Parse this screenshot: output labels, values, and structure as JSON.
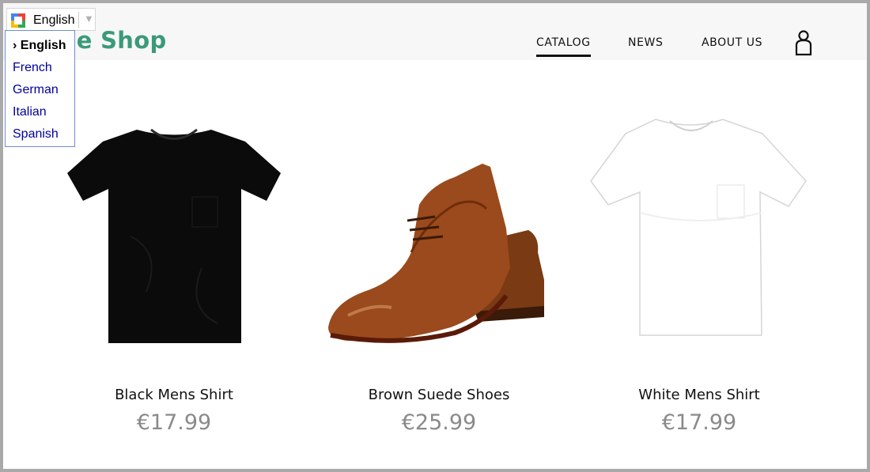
{
  "header": {
    "logo_text": "Acme Shop",
    "nav": [
      {
        "label": "CATALOG",
        "active": true
      },
      {
        "label": "NEWS"
      },
      {
        "label": "ABOUT US"
      }
    ],
    "account_icon": "user-icon"
  },
  "translate": {
    "current": "English",
    "icon": "google-translate-icon",
    "arrow_icon": "chevron-down-icon",
    "options": [
      "English",
      "French",
      "German",
      "Italian",
      "Spanish"
    ],
    "selected_marker": "› English"
  },
  "products": [
    {
      "name": "Black Mens Shirt",
      "price": "€17.99",
      "image": "black-tshirt"
    },
    {
      "name": "Brown Suede Shoes",
      "price": "€25.99",
      "image": "brown-shoes"
    },
    {
      "name": "White Mens Shirt",
      "price": "€17.99",
      "image": "white-tshirt"
    }
  ],
  "colors": {
    "brand": "#3a9a7a",
    "price": "#8a8a8a",
    "link": "#00009c"
  }
}
